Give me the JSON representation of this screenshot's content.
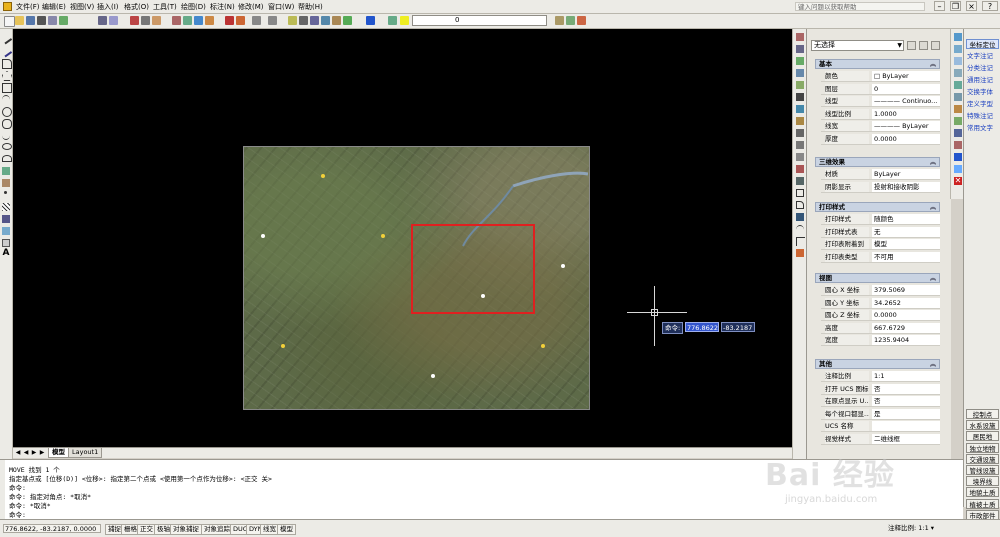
{
  "menu": {
    "items": [
      "文件(F)",
      "编辑(E)",
      "视图(V)",
      "插入(I)",
      "格式(O)",
      "工具(T)",
      "绘图(D)",
      "标注(N)",
      "修改(M)",
      "窗口(W)",
      "帮助(H)"
    ],
    "help_placeholder": "键入问题以获取帮助"
  },
  "toolbar": {
    "layer_value": "0"
  },
  "canvas": {
    "dynamic_input_label": "命令:",
    "dynamic_x": "776.8622",
    "dynamic_y": "-83.2187"
  },
  "layout_tabs": {
    "model": "模型",
    "layout1": "Layout1"
  },
  "properties": {
    "selection": "无选择",
    "sections": [
      {
        "title": "基本",
        "rows": [
          {
            "k": "颜色",
            "v": "□ ByLayer"
          },
          {
            "k": "图层",
            "v": "0"
          },
          {
            "k": "线型",
            "v": "———— Continuo..."
          },
          {
            "k": "线型比例",
            "v": "1.0000"
          },
          {
            "k": "线宽",
            "v": "———— ByLayer"
          },
          {
            "k": "厚度",
            "v": "0.0000"
          }
        ]
      },
      {
        "title": "三维效果",
        "rows": [
          {
            "k": "材质",
            "v": "ByLayer"
          },
          {
            "k": "阴影显示",
            "v": "投射和接收阴影"
          }
        ]
      },
      {
        "title": "打印样式",
        "rows": [
          {
            "k": "打印样式",
            "v": "随颜色"
          },
          {
            "k": "打印样式表",
            "v": "无"
          },
          {
            "k": "打印表附着到",
            "v": "模型"
          },
          {
            "k": "打印表类型",
            "v": "不可用"
          }
        ]
      },
      {
        "title": "视图",
        "rows": [
          {
            "k": "圆心 X 坐标",
            "v": "379.5069"
          },
          {
            "k": "圆心 Y 坐标",
            "v": "34.2652"
          },
          {
            "k": "圆心 Z 坐标",
            "v": "0.0000"
          },
          {
            "k": "高度",
            "v": "667.6729"
          },
          {
            "k": "宽度",
            "v": "1235.9404"
          }
        ]
      },
      {
        "title": "其他",
        "rows": [
          {
            "k": "注释比例",
            "v": "1:1"
          },
          {
            "k": "打开 UCS 图标",
            "v": "否"
          },
          {
            "k": "在原点显示 U...",
            "v": "否"
          },
          {
            "k": "每个视口都显...",
            "v": "是"
          },
          {
            "k": "UCS 名称",
            "v": ""
          },
          {
            "k": "视觉样式",
            "v": "二维线框"
          }
        ]
      }
    ]
  },
  "far_right_top": [
    "坐标定位",
    "文字注记",
    "分类注记",
    "通用注记",
    "交换字体",
    "定义字型",
    "特殊注记",
    "常用文字"
  ],
  "far_right_bottom": [
    "控制点",
    "水系设施",
    "居民地",
    "独立地物",
    "交通设施",
    "管线设施",
    "境界线",
    "地貌土质",
    "植被土质",
    "市政部件"
  ],
  "command": {
    "lines": [
      "MOVE 找到 1 个",
      "指定基点或 [位移(D)] <位移>:  指定第二个点或 <使用第一个点作为位移>:  <正交 关>",
      "命令:",
      "命令: 指定对角点: *取消*",
      "命令: *取消*",
      "命令:"
    ]
  },
  "status": {
    "coords": "776.8622, -83.2187, 0.0000",
    "buttons": [
      "捕捉",
      "栅格",
      "正交",
      "极轴",
      "对象捕捉",
      "对象追踪",
      "DUCS",
      "DYN",
      "线宽",
      "模型"
    ],
    "annotation_scale": "注释比例: 1:1 ▾"
  },
  "watermark": {
    "brand": "Bai 经验",
    "url": "jingyan.baidu.com"
  },
  "colors": {
    "canvas": "#000000",
    "selection_rect": "#e02020",
    "accent": "#1a3fc0"
  }
}
